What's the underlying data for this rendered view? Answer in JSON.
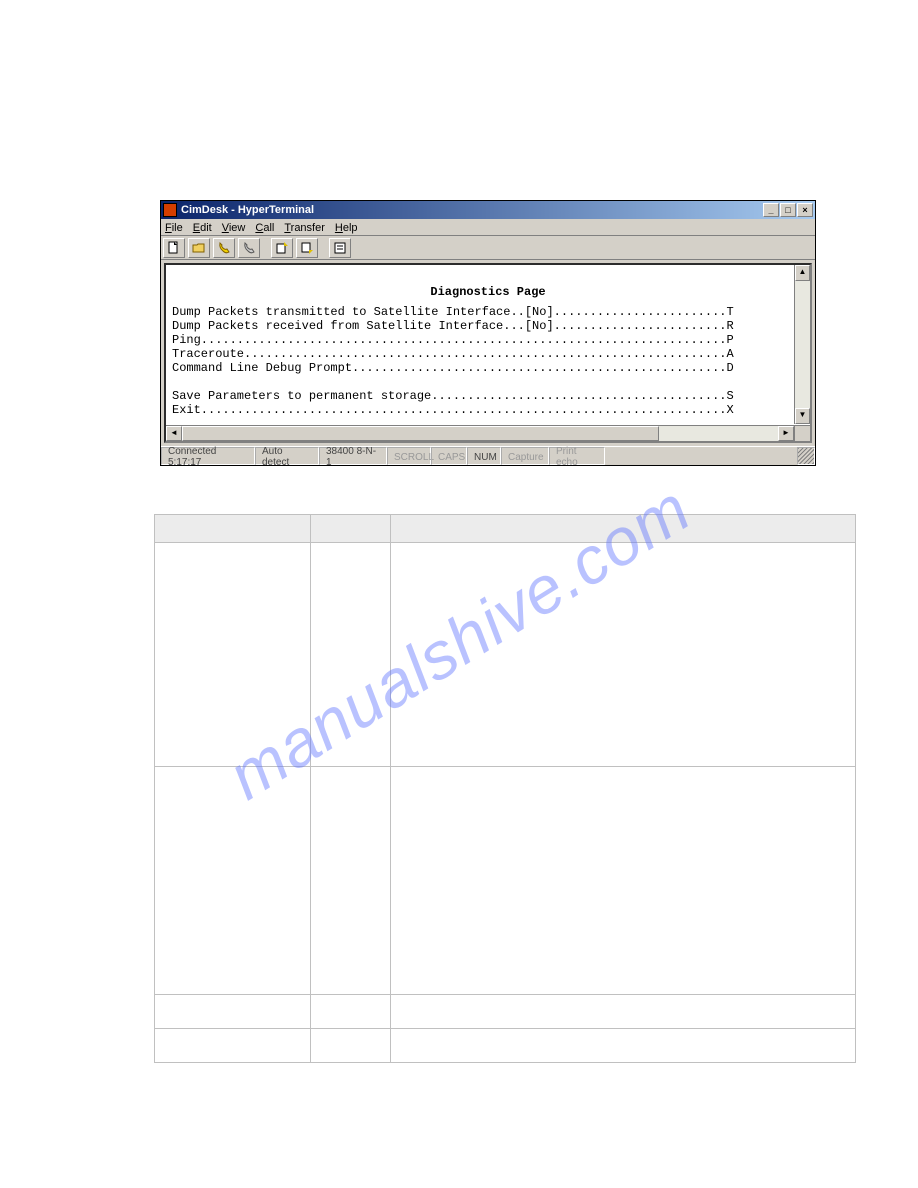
{
  "watermark": "manualshive.com",
  "window": {
    "title": "CimDesk - HyperTerminal",
    "menus": {
      "file": "File",
      "edit": "Edit",
      "view": "View",
      "call": "Call",
      "transfer": "Transfer",
      "help": "Help"
    },
    "toolbar_icons": {
      "new": "new-icon",
      "open": "open-icon",
      "call": "call-icon",
      "disconnect": "disconnect-icon",
      "send": "send-icon",
      "receive": "receive-icon",
      "properties": "properties-icon"
    },
    "terminal": {
      "header": "Diagnostics Page",
      "lines": [
        "Dump Packets transmitted to Satellite Interface..[No]........................T",
        "Dump Packets received from Satellite Interface...[No]........................R",
        "Ping.........................................................................P",
        "Traceroute...................................................................A",
        "Command Line Debug Prompt....................................................D",
        "",
        "Save Parameters to permanent storage.........................................S",
        "Exit.........................................................................X",
        "_"
      ]
    },
    "status": {
      "connected": "Connected 5:17:17",
      "detect": "Auto detect",
      "port": "38400 8-N-1",
      "scroll": "SCROLL",
      "caps": "CAPS",
      "num": "NUM",
      "capture": "Capture",
      "printecho": "Print echo"
    },
    "buttons": {
      "minimize": "_",
      "maximize": "□",
      "close": "×"
    }
  }
}
